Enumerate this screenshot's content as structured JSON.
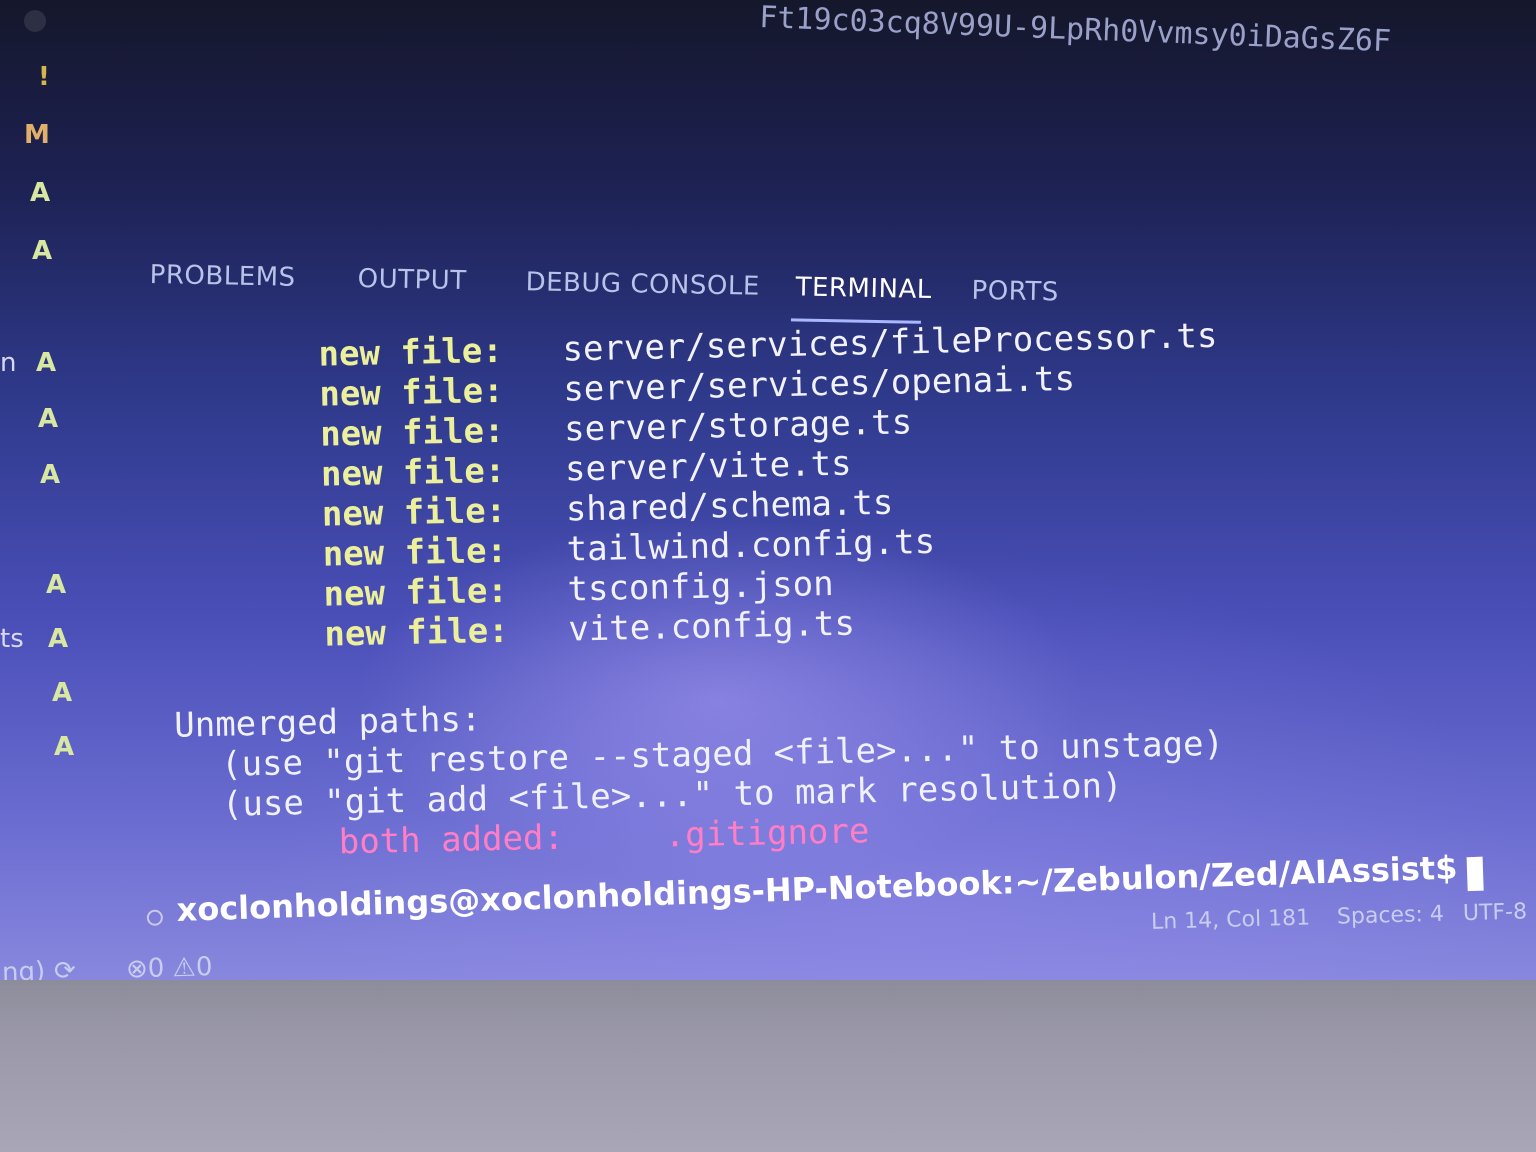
{
  "editor_top": {
    "hash_text": "Ft19c03cq8V99U-9LpRh0Vvmsy0iDaGsZ6F"
  },
  "gutter": {
    "marks": [
      "!",
      "M",
      "A",
      "A",
      "A",
      "A",
      "A",
      "A",
      "A",
      "A",
      "A"
    ],
    "edge_texts": [
      "n",
      "ts"
    ]
  },
  "panel": {
    "tabs": [
      {
        "label": "PROBLEMS"
      },
      {
        "label": "OUTPUT"
      },
      {
        "label": "DEBUG CONSOLE"
      },
      {
        "label": "TERMINAL"
      },
      {
        "label": "PORTS"
      }
    ],
    "active_tab": "TERMINAL"
  },
  "terminal": {
    "new_files": [
      {
        "label": "new file:",
        "path": "server/services/fileProcessor.ts"
      },
      {
        "label": "new file:",
        "path": "server/services/openai.ts"
      },
      {
        "label": "new file:",
        "path": "server/storage.ts"
      },
      {
        "label": "new file:",
        "path": "server/vite.ts"
      },
      {
        "label": "new file:",
        "path": "shared/schema.ts"
      },
      {
        "label": "new file:",
        "path": "tailwind.config.ts"
      },
      {
        "label": "new file:",
        "path": "tsconfig.json"
      },
      {
        "label": "new file:",
        "path": "vite.config.ts"
      }
    ],
    "unmerged_header": "Unmerged paths:",
    "hint_restore": "(use \"git restore --staged <file>...\" to unstage)",
    "hint_add": "(use \"git add <file>...\" to mark resolution)",
    "conflict": {
      "label": "both added:",
      "path": ".gitignore"
    },
    "prompt": "xoclonholdings@xoclonholdings-HP-Notebook:~/Zebulon/Zed/AIAssist$"
  },
  "statusbar": {
    "branch_fragment": "ng)",
    "errors": "0",
    "warnings": "0",
    "cursor_position": "Ln 14, Col 181",
    "indentation": "Spaces: 4",
    "encoding": "UTF-8"
  },
  "colors": {
    "label": "#ecf09a",
    "conflict": "#ff7ec5",
    "active_tab_underline": "#a9b7ff"
  }
}
